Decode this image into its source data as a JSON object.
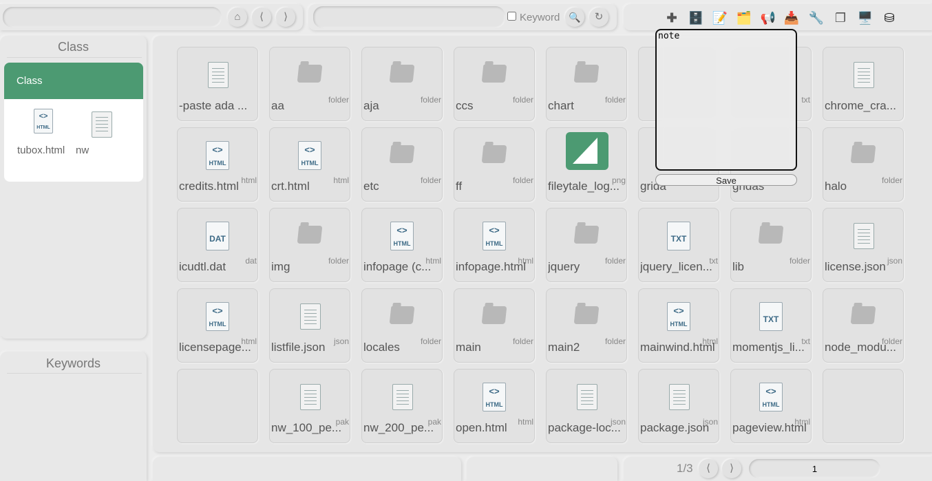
{
  "topbar": {
    "path_value": "",
    "search_value": "",
    "keyword_label": "Keyword",
    "keyword_checked": false
  },
  "sidebar": {
    "class_title": "Class",
    "selected_class": "Class",
    "class_files": [
      {
        "name": "tubox.html",
        "type": "html"
      },
      {
        "name": "nw",
        "type": "doc"
      }
    ],
    "keywords_title": "Keywords"
  },
  "files": [
    {
      "name": "-paste ada ...",
      "ext": "",
      "icon": "doc"
    },
    {
      "name": "aa",
      "ext": "folder",
      "icon": "folder"
    },
    {
      "name": "aja",
      "ext": "folder",
      "icon": "folder"
    },
    {
      "name": "ccs",
      "ext": "folder",
      "icon": "folder"
    },
    {
      "name": "chart",
      "ext": "folder",
      "icon": "folder"
    },
    {
      "name": "",
      "ext": "",
      "icon": "none"
    },
    {
      "name": "",
      "ext": "txt",
      "icon": "none"
    },
    {
      "name": "chrome_cra...",
      "ext": "",
      "icon": "doc"
    },
    {
      "name": "credits.html",
      "ext": "html",
      "icon": "html"
    },
    {
      "name": "crt.html",
      "ext": "html",
      "icon": "html"
    },
    {
      "name": "etc",
      "ext": "folder",
      "icon": "folder"
    },
    {
      "name": "ff",
      "ext": "folder",
      "icon": "folder"
    },
    {
      "name": "fileytale_log...",
      "ext": "png",
      "icon": "image"
    },
    {
      "name": "grida",
      "ext": "",
      "icon": "none"
    },
    {
      "name": "gridas",
      "ext": "",
      "icon": "none"
    },
    {
      "name": "halo",
      "ext": "folder",
      "icon": "folder"
    },
    {
      "name": "icudtl.dat",
      "ext": "dat",
      "icon": "dat"
    },
    {
      "name": "img",
      "ext": "folder",
      "icon": "folder"
    },
    {
      "name": "infopage (c...",
      "ext": "html",
      "icon": "html"
    },
    {
      "name": "infopage.html",
      "ext": "html",
      "icon": "html"
    },
    {
      "name": "jquery",
      "ext": "folder",
      "icon": "folder"
    },
    {
      "name": "jquery_licen...",
      "ext": "txt",
      "icon": "txt"
    },
    {
      "name": "lib",
      "ext": "folder",
      "icon": "folder"
    },
    {
      "name": "license.json",
      "ext": "json",
      "icon": "doc"
    },
    {
      "name": "licensepage...",
      "ext": "html",
      "icon": "html"
    },
    {
      "name": "listfile.json",
      "ext": "json",
      "icon": "doc"
    },
    {
      "name": "locales",
      "ext": "folder",
      "icon": "folder"
    },
    {
      "name": "main",
      "ext": "folder",
      "icon": "folder"
    },
    {
      "name": "main2",
      "ext": "folder",
      "icon": "folder"
    },
    {
      "name": "mainwind.html",
      "ext": "html",
      "icon": "html"
    },
    {
      "name": "momentjs_li...",
      "ext": "txt",
      "icon": "txt"
    },
    {
      "name": "node_modu...",
      "ext": "folder",
      "icon": "folder"
    },
    {
      "name": "",
      "ext": "",
      "icon": "none"
    },
    {
      "name": "nw_100_pe...",
      "ext": "pak",
      "icon": "doc"
    },
    {
      "name": "nw_200_pe...",
      "ext": "pak",
      "icon": "doc"
    },
    {
      "name": "open.html",
      "ext": "html",
      "icon": "html"
    },
    {
      "name": "package-loc...",
      "ext": "json",
      "icon": "doc"
    },
    {
      "name": "package.json",
      "ext": "json",
      "icon": "doc"
    },
    {
      "name": "pageview.html",
      "ext": "html",
      "icon": "html"
    },
    {
      "name": "",
      "ext": "",
      "icon": "none"
    }
  ],
  "note": {
    "value": "note",
    "save_label": "Save"
  },
  "pager": {
    "page_label": "1/3",
    "page_input": "1"
  },
  "colors": {
    "accent": "#4c9a72",
    "background": "#ececec"
  }
}
